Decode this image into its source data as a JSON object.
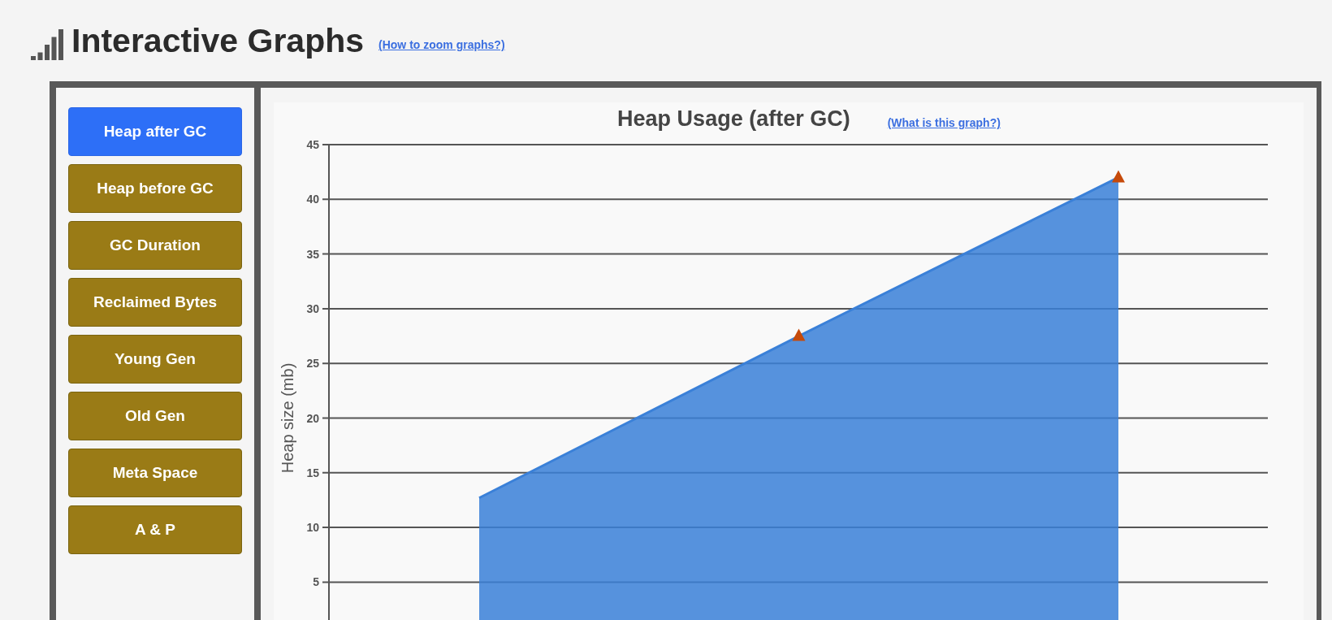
{
  "header": {
    "title": "Interactive Graphs",
    "help_link": "(How to zoom graphs?)"
  },
  "graph_menu": [
    {
      "label": "Heap after GC",
      "selected": true
    },
    {
      "label": "Heap before GC",
      "selected": false
    },
    {
      "label": "GC Duration",
      "selected": false
    },
    {
      "label": "Reclaimed Bytes",
      "selected": false
    },
    {
      "label": "Young Gen",
      "selected": false
    },
    {
      "label": "Old Gen",
      "selected": false
    },
    {
      "label": "Meta Space",
      "selected": false
    },
    {
      "label": "A & P",
      "selected": false
    }
  ],
  "graph": {
    "title": "Heap Usage (after GC)",
    "help_link": "(What is this graph?)",
    "chart_data": {
      "type": "area",
      "ylabel": "Heap size (mb)",
      "yticks": [
        5,
        10,
        15,
        20,
        25,
        30,
        35,
        40,
        45
      ],
      "ylim": [
        0,
        45
      ],
      "grid": true,
      "series": [
        {
          "color": "#3a80d8",
          "values": [
            12.7,
            27.5,
            42.0
          ]
        }
      ]
    }
  }
}
